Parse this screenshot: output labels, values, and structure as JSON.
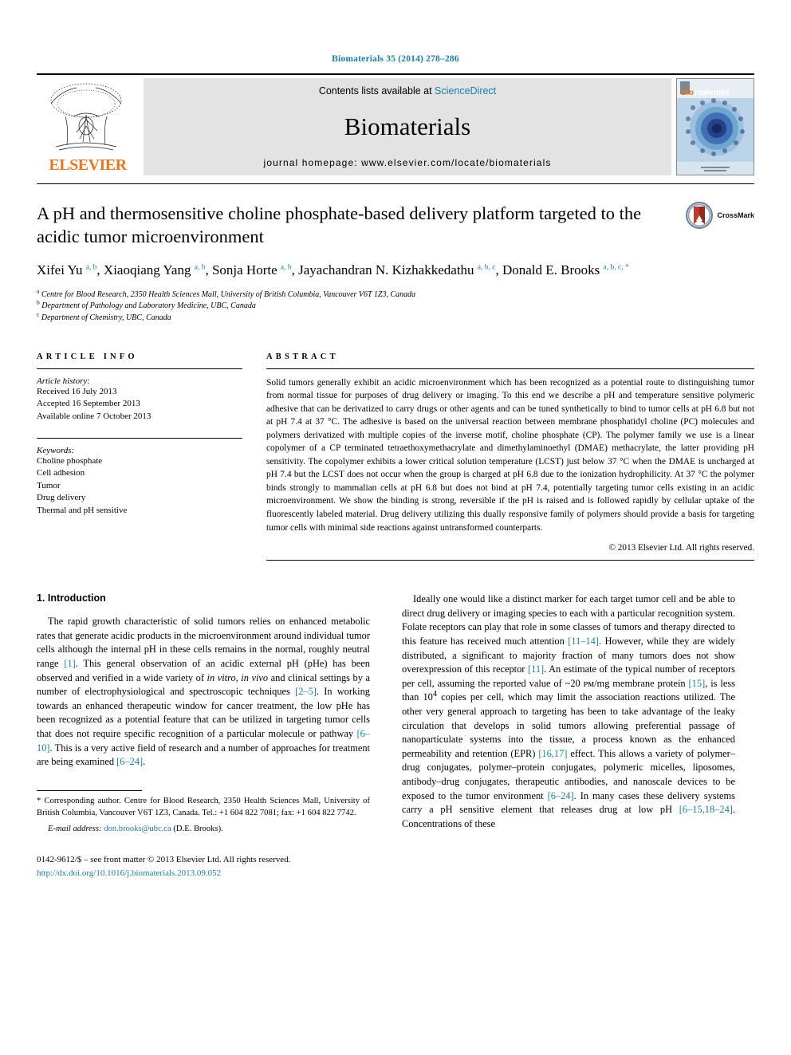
{
  "running_head": "Biomaterials 35 (2014) 278–286",
  "masthead": {
    "publisher": "ELSEVIER",
    "contents_prefix": "Contents lists available at ",
    "contents_link": "ScienceDirect",
    "journal_name": "Biomaterials",
    "homepage": "journal homepage: www.elsevier.com/locate/biomaterials",
    "cover_title": "Biomaterials",
    "link_color": "#1a7fa8",
    "elsevier_orange": "#e87722"
  },
  "article": {
    "title": "A pH and thermosensitive choline phosphate-based delivery platform targeted to the acidic tumor microenvironment",
    "crossmark_label": "CrossMark",
    "authors": [
      {
        "name": "Xifei Yu",
        "sup": "a, b",
        "sep": ", "
      },
      {
        "name": "Xiaoqiang Yang",
        "sup": "a, b",
        "sep": ", "
      },
      {
        "name": "Sonja Horte",
        "sup": "a, b",
        "sep": ", "
      },
      {
        "name": "Jayachandran N. Kizhakkedathu",
        "sup": "a, b, c",
        "sep": ", "
      },
      {
        "name": "Donald E. Brooks",
        "sup": "a, b, c, *",
        "sep": ""
      }
    ],
    "affiliations": [
      {
        "marker": "a",
        "text": "Centre for Blood Research, 2350 Health Sciences Mall, University of British Columbia, Vancouver V6T 1Z3, Canada"
      },
      {
        "marker": "b",
        "text": "Department of Pathology and Laboratory Medicine, UBC, Canada"
      },
      {
        "marker": "c",
        "text": "Department of Chemistry, UBC, Canada"
      }
    ]
  },
  "article_info": {
    "heading": "ARTICLE INFO",
    "history_title": "Article history:",
    "history": [
      "Received 16 July 2013",
      "Accepted 16 September 2013",
      "Available online 7 October 2013"
    ],
    "keywords_title": "Keywords:",
    "keywords": [
      "Choline phosphate",
      "Cell adhesion",
      "Tumor",
      "Drug delivery",
      "Thermal and pH sensitive"
    ]
  },
  "abstract": {
    "heading": "ABSTRACT",
    "text": "Solid tumors generally exhibit an acidic microenvironment which has been recognized as a potential route to distinguishing tumor from normal tissue for purposes of drug delivery or imaging. To this end we describe a pH and temperature sensitive polymeric adhesive that can be derivatized to carry drugs or other agents and can be tuned synthetically to bind to tumor cells at pH 6.8 but not at pH 7.4 at 37 °C. The adhesive is based on the universal reaction between membrane phosphatidyl choline (PC) molecules and polymers derivatized with multiple copies of the inverse motif, choline phosphate (CP). The polymer family we use is a linear copolymer of a CP terminated tetraethoxymethacrylate and dimethylaminoethyl (DMAE) methacrylate, the latter providing pH sensitivity. The copolymer exhibits a lower critical solution temperature (LCST) just below 37 °C when the DMAE is uncharged at pH 7.4 but the LCST does not occur when the group is charged at pH 6.8 due to the ionization hydrophilicity. At 37 °C the polymer binds strongly to mammalian cells at pH 6.8 but does not bind at pH 7.4, potentially targeting tumor cells existing in an acidic microenvironment. We show the binding is strong, reversible if the pH is raised and is followed rapidly by cellular uptake of the fluorescently labeled material. Drug delivery utilizing this dually responsive family of polymers should provide a basis for targeting tumor cells with minimal side reactions against untransformed counterparts.",
    "copyright": "© 2013 Elsevier Ltd. All rights reserved."
  },
  "introduction": {
    "heading": "1. Introduction",
    "left_para_1_a": "The rapid growth characteristic of solid tumors relies on enhanced metabolic rates that generate acidic products in the microenvironment around individual tumor cells although the internal pH in these cells remains in the normal, roughly neutral range ",
    "cite_1": "[1]",
    "left_para_1_b": ". This general observation of an acidic external pH (pHe) has been observed and verified in a wide variety of ",
    "italic_1": "in vitro, in vivo",
    "left_para_1_c": " and clinical settings by a number of electrophysiological and spectroscopic techniques ",
    "cite_2_5": "[2–5]",
    "left_para_1_d": ". In working towards an enhanced therapeutic window for cancer treatment, the low pHe has been recognized as a potential feature that can be utilized in targeting tumor cells that does not require specific recognition of a particular molecule or pathway ",
    "cite_6_10": "[6–10]",
    "left_para_1_e": ". This is a very active field of research and a number of approaches for treatment are being examined ",
    "cite_6_24": "[6–24]",
    "left_para_1_f": ".",
    "right_para_1_a": "Ideally one would like a distinct marker for each target tumor cell and be able to direct drug delivery or imaging species to each with a particular recognition system. Folate receptors can play that role in some classes of tumors and therapy directed to this feature has received much attention ",
    "cite_11_14": "[11–14]",
    "right_para_1_b": ". However, while they are widely distributed, a significant to majority fraction of many tumors does not show overexpression of this receptor ",
    "cite_11": "[11]",
    "right_para_1_c": ". An estimate of the typical number of receptors per cell, assuming the reported value of ~20 ᴘᴍ/mg membrane protein ",
    "cite_15": "[15]",
    "right_para_1_d": ", is less than 10",
    "exp_4": "4",
    "right_para_1_e": " copies per cell, which may limit the association reactions utilized. The other very general approach to targeting has been to take advantage of the leaky circulation that develops in solid tumors allowing preferential passage of nanoparticulate systems into the tissue, a process known as the enhanced permeability and retention (EPR) ",
    "cite_16_17": "[16,17]",
    "right_para_1_f": " effect. This allows a variety of polymer–drug conjugates, polymer–protein conjugates, polymeric micelles, liposomes, antibody–drug conjugates, therapeutic antibodies, and nanoscale devices to be exposed to the tumor environment ",
    "cite_6_24_b": "[6–24]",
    "right_para_1_g": ". In many cases these delivery systems carry a pH sensitive element that releases drug at low pH ",
    "cite_6_15_18_24": "[6–15,18–24]",
    "right_para_1_h": ". Concentrations of these"
  },
  "footnote": {
    "star": "*",
    "text": " Corresponding author. Centre for Blood Research, 2350 Health Sciences Mall, University of British Columbia, Vancouver V6T 1Z3, Canada. Tel.: +1 604 822 7081; fax: +1 604 822 7742.",
    "email_label": "E-mail address:",
    "email": "don.brooks@ubc.ca",
    "email_suffix": " (D.E. Brooks)."
  },
  "publisher_footer": {
    "issn_line": "0142-9612/$ – see front matter © 2013 Elsevier Ltd. All rights reserved.",
    "doi": "http://dx.doi.org/10.1016/j.biomaterials.2013.09.052"
  }
}
